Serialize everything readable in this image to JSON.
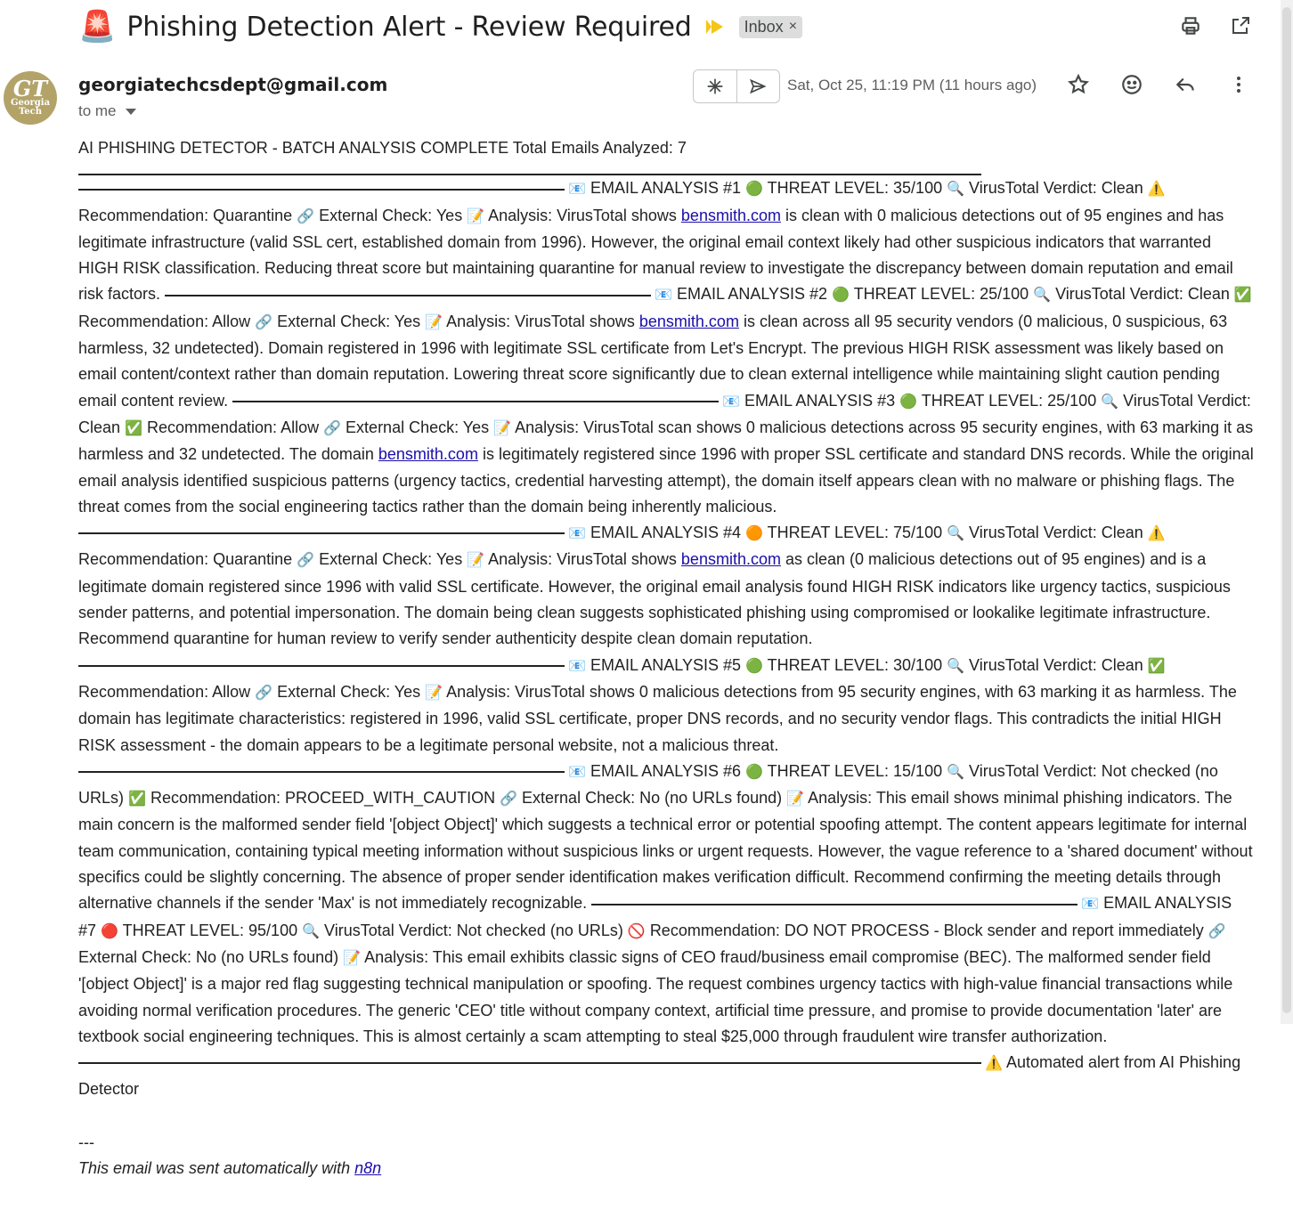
{
  "subject": {
    "emoji": "🚨",
    "title": "Phishing Detection Alert - Review Required",
    "label": "Inbox",
    "label_remove": "×"
  },
  "top_icons": [
    "print-icon",
    "open-in-new-window-icon"
  ],
  "sender": {
    "avatar_mono": "GT",
    "avatar_name": "Georgia Tech",
    "email": "georgiatechcsdept@gmail.com",
    "to": "to me"
  },
  "header": {
    "date": "Sat, Oct 25, 11:19 PM (11 hours ago)",
    "icons": [
      "summarize-icon",
      "send-icon",
      "star-icon",
      "emoji-react-icon",
      "reply-icon",
      "more-options-icon"
    ]
  },
  "body": {
    "intro": "AI PHISHING DETECTOR - BATCH ANALYSIS COMPLETE Total Emails Analyzed: 7",
    "analyses": [
      {
        "heading": "EMAIL ANALYSIS #1",
        "threat_icon": "🟢",
        "threat": "THREAT LEVEL: 35/100",
        "verdict": "VirusTotal Verdict: Clean",
        "rec_icon": "⚠️",
        "recommendation": "Recommendation: Quarantine",
        "external": "External Check: Yes",
        "analysis_pre": "Analysis: VirusTotal shows ",
        "link": "bensmith.com",
        "analysis_post": " is clean with 0 malicious detections out of 95 engines and has legitimate infrastructure (valid SSL cert, established domain from 1996). However, the original email context likely had other suspicious indicators that warranted HIGH RISK classification. Reducing threat score but maintaining quarantine for manual review to investigate the discrepancy between domain reputation and email risk factors."
      },
      {
        "heading": "EMAIL ANALYSIS #2",
        "threat_icon": "🟢",
        "threat": "THREAT LEVEL: 25/100",
        "verdict": "VirusTotal Verdict: Clean",
        "rec_icon": "✅",
        "recommendation": "Recommendation: Allow",
        "external": "External Check: Yes",
        "analysis_pre": "Analysis: VirusTotal shows ",
        "link": "bensmith.com",
        "analysis_post": " is clean across all 95 security vendors (0 malicious, 0 suspicious, 63 harmless, 32 undetected). Domain registered in 1996 with legitimate SSL certificate from Let's Encrypt. The previous HIGH RISK assessment was likely based on email content/context rather than domain reputation. Lowering threat score significantly due to clean external intelligence while maintaining slight caution pending email content review."
      },
      {
        "heading": "EMAIL ANALYSIS #3",
        "threat_icon": "🟢",
        "threat": "THREAT LEVEL: 25/100",
        "verdict": "VirusTotal Verdict: Clean",
        "rec_icon": "✅",
        "recommendation": "Recommendation: Allow",
        "external": "External Check: Yes",
        "analysis_pre": "Analysis: VirusTotal scan shows 0 malicious detections across 95 security engines, with 63 marking it as harmless and 32 undetected. The domain ",
        "link": "bensmith.com",
        "analysis_post": " is legitimately registered since 1996 with proper SSL certificate and standard DNS records. While the original email analysis identified suspicious patterns (urgency tactics, credential harvesting attempt), the domain itself appears clean with no malware or phishing flags. The threat comes from the social engineering tactics rather than the domain being inherently malicious."
      },
      {
        "heading": "EMAIL ANALYSIS #4",
        "threat_icon": "🟠",
        "threat": "THREAT LEVEL: 75/100",
        "verdict": "VirusTotal Verdict: Clean",
        "rec_icon": "⚠️",
        "recommendation": "Recommendation: Quarantine",
        "external": "External Check: Yes",
        "analysis_pre": "Analysis: VirusTotal shows ",
        "link": "bensmith.com",
        "analysis_post": " as clean (0 malicious detections out of 95 engines) and is a legitimate domain registered since 1996 with valid SSL certificate. However, the original email analysis found HIGH RISK indicators like urgency tactics, suspicious sender patterns, and potential impersonation. The domain being clean suggests sophisticated phishing using compromised or lookalike legitimate infrastructure. Recommend quarantine for human review to verify sender authenticity despite clean domain reputation."
      },
      {
        "heading": "EMAIL ANALYSIS #5",
        "threat_icon": "🟢",
        "threat": "THREAT LEVEL: 30/100",
        "verdict": "VirusTotal Verdict: Clean",
        "rec_icon": "✅",
        "recommendation": "Recommendation: Allow",
        "external": "External Check: Yes",
        "analysis_pre": "Analysis: VirusTotal shows 0 malicious detections from 95 security engines, with 63 marking it as harmless. The domain has legitimate characteristics: registered in 1996, valid SSL certificate, proper DNS records, and no security vendor flags. This contradicts the initial HIGH RISK assessment - the domain appears to be a legitimate personal website, not a malicious threat.",
        "link": "",
        "analysis_post": ""
      },
      {
        "heading": "EMAIL ANALYSIS #6",
        "threat_icon": "🟢",
        "threat": "THREAT LEVEL: 15/100",
        "verdict": "VirusTotal Verdict: Not checked (no URLs)",
        "rec_icon": "✅",
        "recommendation": "Recommendation: PROCEED_WITH_CAUTION",
        "external": "External Check: No (no URLs found)",
        "analysis_pre": "Analysis: This email shows minimal phishing indicators. The main concern is the malformed sender field '[object Object]' which suggests a technical error or potential spoofing attempt. The content appears legitimate for internal team communication, containing typical meeting information without suspicious links or urgent requests. However, the vague reference to a 'shared document' without specifics could be slightly concerning. The absence of proper sender identification makes verification difficult. Recommend confirming the meeting details through alternative channels if the sender 'Max' is not immediately recognizable.",
        "link": "",
        "analysis_post": ""
      },
      {
        "heading": "EMAIL ANALYSIS #7",
        "threat_icon": "🔴",
        "threat": "THREAT LEVEL: 95/100",
        "verdict": "VirusTotal Verdict: Not checked (no URLs)",
        "rec_icon": "🚫",
        "recommendation": "Recommendation: DO NOT PROCESS - Block sender and report immediately",
        "external": "External Check: No (no URLs found)",
        "analysis_pre": "Analysis: This email exhibits classic signs of CEO fraud/business email compromise (BEC). The malformed sender field '[object Object]' is a major red flag suggesting technical manipulation or spoofing. The request combines urgency tactics with high-value financial transactions while avoiding normal verification procedures. The generic 'CEO' title without company context, artificial time pressure, and promise to provide documentation 'later' are textbook social engineering techniques. This is almost certainly a scam attempting to steal $25,000 through fraudulent wire transfer authorization.",
        "link": "",
        "analysis_post": ""
      }
    ],
    "outro_icon": "⚠️",
    "outro": "Automated alert from AI Phishing Detector",
    "sig_dash": "---",
    "sig_text": "This email was sent automatically with ",
    "sig_link": "n8n"
  },
  "emoji": {
    "email": "📧",
    "search": "🔍",
    "link": "🔗",
    "memo": "📝"
  }
}
